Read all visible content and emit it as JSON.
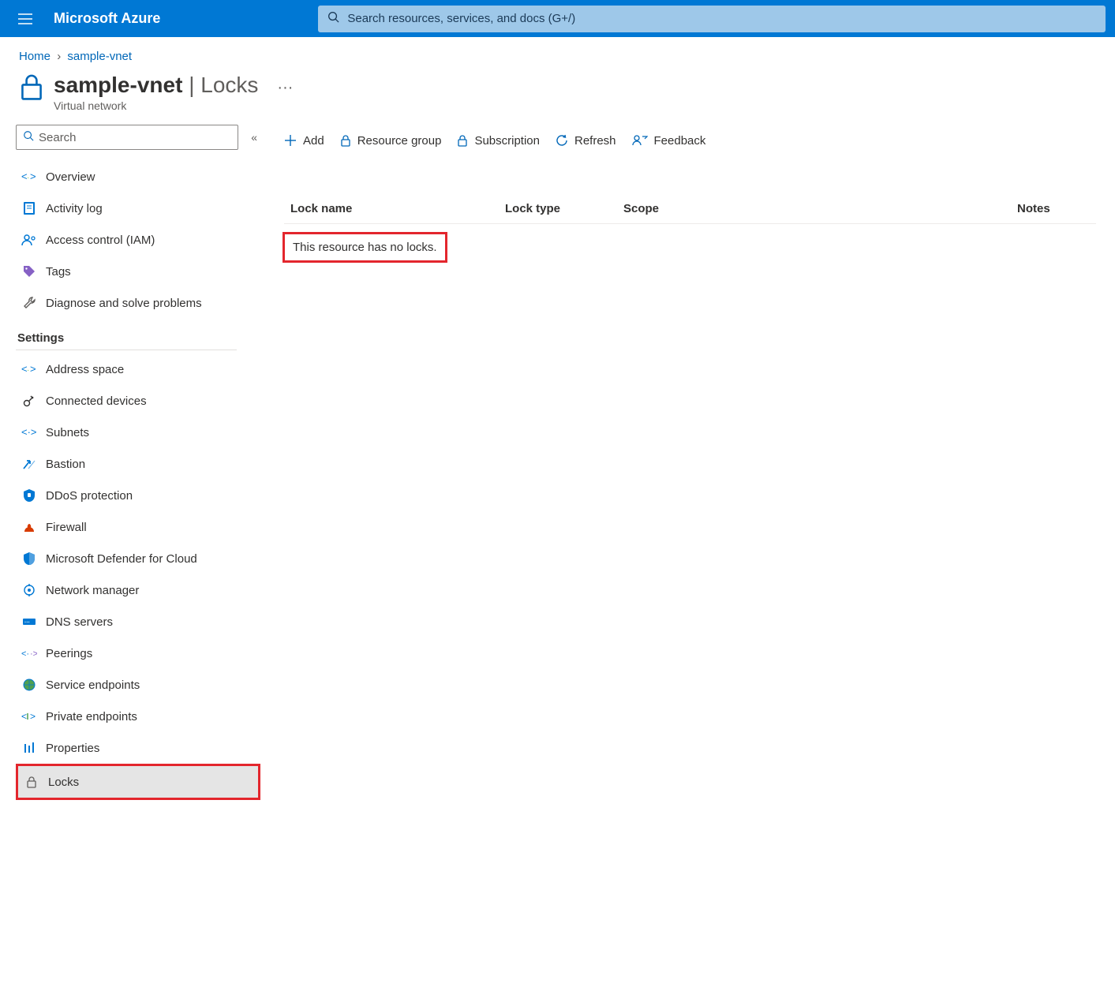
{
  "topbar": {
    "brand": "Microsoft Azure",
    "search_placeholder": "Search resources, services, and docs (G+/)"
  },
  "breadcrumb": {
    "home": "Home",
    "current": "sample-vnet"
  },
  "header": {
    "resource": "sample-vnet",
    "panel": "Locks",
    "subtitle": "Virtual network"
  },
  "sidebar": {
    "search_placeholder": "Search",
    "main": [
      {
        "label": "Overview"
      },
      {
        "label": "Activity log"
      },
      {
        "label": "Access control (IAM)"
      },
      {
        "label": "Tags"
      },
      {
        "label": "Diagnose and solve problems"
      }
    ],
    "settings_header": "Settings",
    "settings": [
      {
        "label": "Address space"
      },
      {
        "label": "Connected devices"
      },
      {
        "label": "Subnets"
      },
      {
        "label": "Bastion"
      },
      {
        "label": "DDoS protection"
      },
      {
        "label": "Firewall"
      },
      {
        "label": "Microsoft Defender for Cloud"
      },
      {
        "label": "Network manager"
      },
      {
        "label": "DNS servers"
      },
      {
        "label": "Peerings"
      },
      {
        "label": "Service endpoints"
      },
      {
        "label": "Private endpoints"
      },
      {
        "label": "Properties"
      },
      {
        "label": "Locks"
      }
    ]
  },
  "commands": {
    "add": "Add",
    "resource_group": "Resource group",
    "subscription": "Subscription",
    "refresh": "Refresh",
    "feedback": "Feedback"
  },
  "table": {
    "columns": {
      "name": "Lock name",
      "type": "Lock type",
      "scope": "Scope",
      "notes": "Notes"
    },
    "empty": "This resource has no locks."
  }
}
